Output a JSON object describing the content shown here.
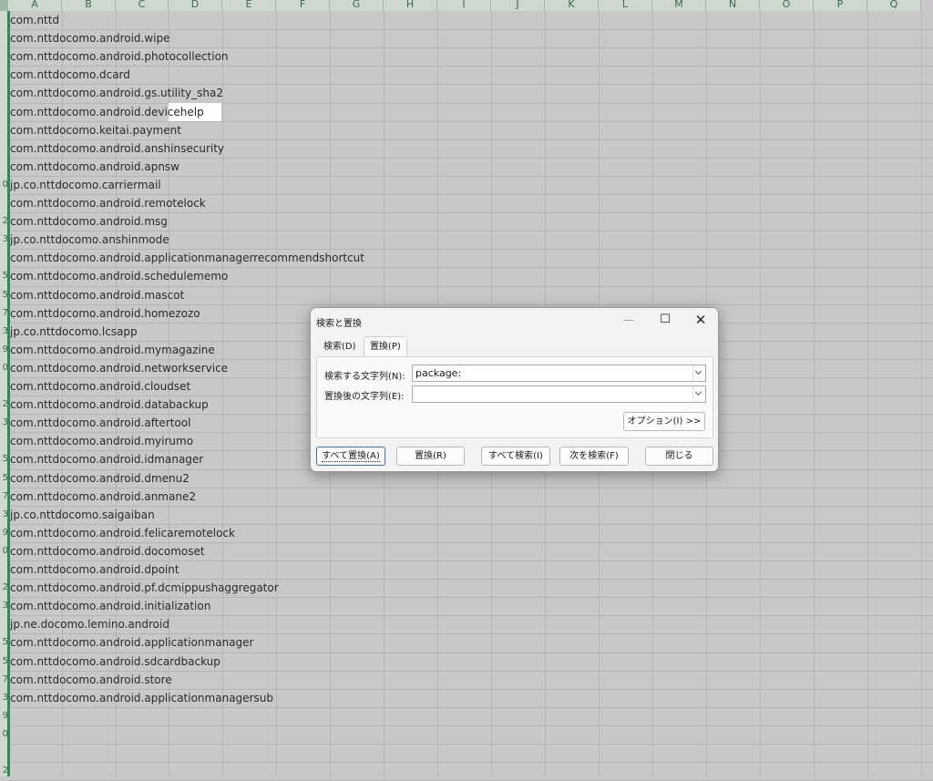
{
  "spreadsheet": {
    "columns": [
      "A",
      "B",
      "C",
      "D",
      "E",
      "F",
      "G",
      "H",
      "I",
      "J",
      "K",
      "L",
      "M",
      "N",
      "O",
      "P",
      "Q"
    ],
    "row_numbers": [
      "",
      "",
      "",
      "",
      "",
      "",
      "",
      "",
      "",
      "0",
      "",
      "2",
      "3",
      "",
      "5",
      "5",
      "7",
      "3",
      "9",
      "0",
      "",
      "2",
      "3",
      "",
      "5",
      "5",
      "7",
      "3",
      "9",
      "0",
      "",
      "2",
      "3",
      "",
      "5",
      "5",
      "7",
      "3",
      "9",
      "0",
      "",
      "2"
    ],
    "cells": [
      "com.nttd",
      "com.nttdocomo.android.wipe",
      "com.nttdocomo.android.photocollection",
      "com.nttdocomo.dcard",
      "com.nttdocomo.android.gs.utility_sha2",
      "com.nttdocomo.android.devicehelp",
      "com.nttdocomo.keitai.payment",
      "com.nttdocomo.android.anshinsecurity",
      "com.nttdocomo.android.apnsw",
      "jp.co.nttdocomo.carriermail",
      "com.nttdocomo.android.remotelock",
      "com.nttdocomo.android.msg",
      "jp.co.nttdocomo.anshinmode",
      "com.nttdocomo.android.applicationmanagerrecommendshortcut",
      "com.nttdocomo.android.schedulememo",
      "com.nttdocomo.android.mascot",
      "com.nttdocomo.android.homezozo",
      "jp.co.nttdocomo.lcsapp",
      "com.nttdocomo.android.mymagazine",
      "com.nttdocomo.android.networkservice",
      "com.nttdocomo.android.cloudset",
      "com.nttdocomo.android.databackup",
      "com.nttdocomo.android.aftertool",
      "com.nttdocomo.android.myirumo",
      "com.nttdocomo.android.idmanager",
      "com.nttdocomo.android.dmenu2",
      "com.nttdocomo.android.anmane2",
      "jp.co.nttdocomo.saigaiban",
      "com.nttdocomo.android.felicaremotelock",
      "com.nttdocomo.android.docomoset",
      "com.nttdocomo.android.dpoint",
      "com.nttdocomo.android.pf.dcmippushaggregator",
      "com.nttdocomo.android.initialization",
      "jp.ne.docomo.lemino.android",
      "com.nttdocomo.android.applicationmanager",
      "com.nttdocomo.android.sdcardbackup",
      "com.nttdocomo.android.store",
      "com.nttdocomo.android.applicationmanagersub"
    ]
  },
  "dialog": {
    "title": "検索と置換",
    "minimize_glyph": "—",
    "maximize_glyph": "☐",
    "close_glyph": "✕",
    "tabs": {
      "find": "検索(D)",
      "replace": "置換(P)"
    },
    "find_label": "検索する文字列(N):",
    "find_value": "package:",
    "replace_label": "置換後の文字列(E):",
    "replace_value": "",
    "options_button": "オプション(I) >>",
    "buttons": {
      "replace_all": "すべて置換(A)",
      "replace": "置換(R)",
      "find_all": "すべて検索(I)",
      "find_next": "次を検索(F)",
      "close": "閉じる"
    }
  }
}
